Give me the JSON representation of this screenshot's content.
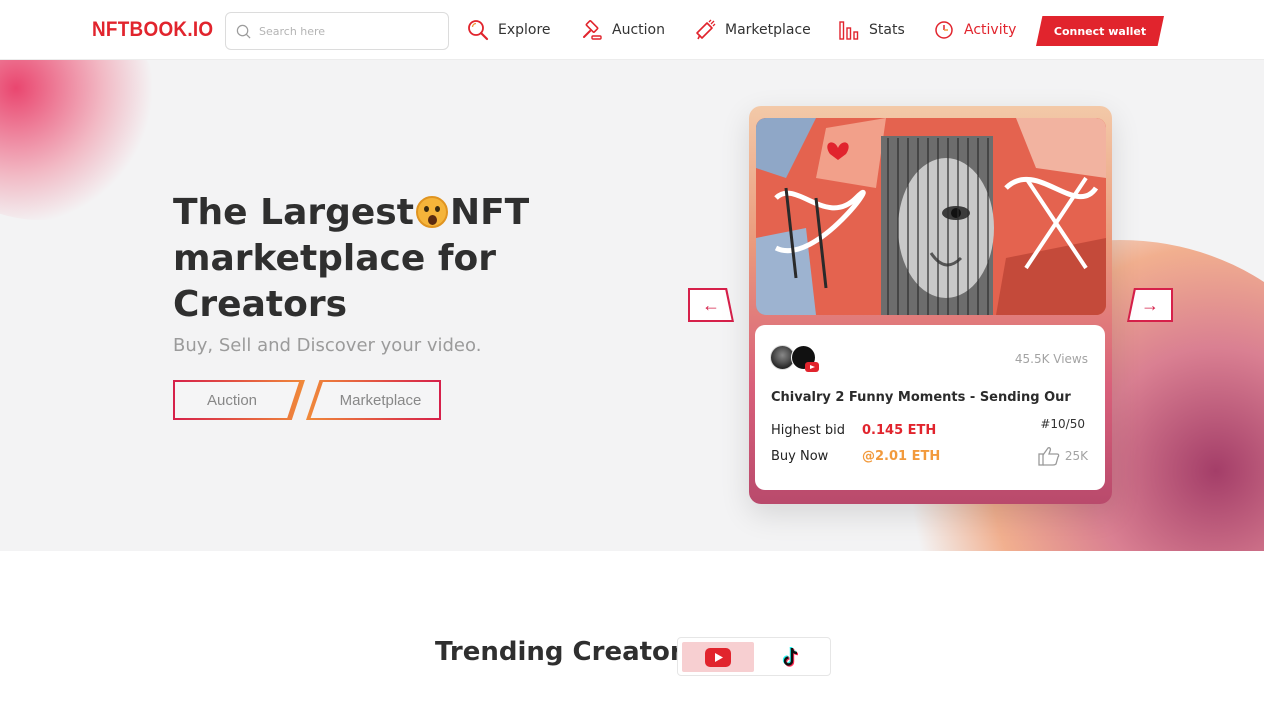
{
  "brand": {
    "logo": "NFTBOOK.IO",
    "accent": "#e1242d"
  },
  "search": {
    "placeholder": "Search here",
    "value": ""
  },
  "nav": {
    "explore": "Explore",
    "auction": "Auction",
    "marketplace": "Marketplace",
    "stats": "Stats",
    "activity": "Activity",
    "active_item": "activity",
    "connect": "Connect wallet"
  },
  "hero": {
    "title_part1": "The Largest",
    "title_emoji": "astonished-face-emoji",
    "title_part2": "NFT",
    "title_line2": "marketplace for",
    "title_line3": "Creators",
    "subtitle": "Buy, Sell and Discover your video.",
    "auction_button": "Auction",
    "marketplace_button": "Marketplace",
    "prev_icon": "arrow-left-icon",
    "next_icon": "arrow-right-icon"
  },
  "card": {
    "views": "45.5K Views",
    "title": "Chivalry 2 Funny Moments - Sending Our",
    "edition": "#10/50",
    "highest_bid_label": "Highest bid",
    "highest_bid_value": "0.145 ETH",
    "buy_now_label": "Buy Now",
    "buy_now_value": "@2.01 ETH",
    "likes": "25K",
    "platform_icon": "youtube-icon"
  },
  "trending": {
    "title": "Trending Creators",
    "platforms": [
      "youtube-icon",
      "tiktok-icon"
    ],
    "selected_platform": "youtube"
  }
}
